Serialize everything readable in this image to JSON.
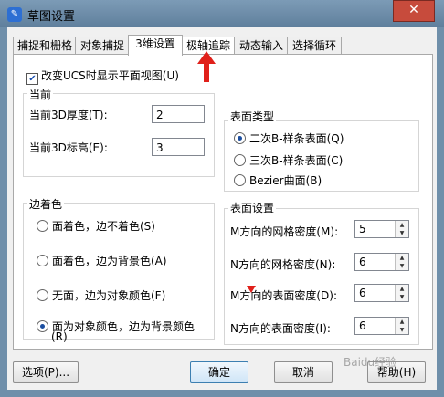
{
  "window": {
    "title": "草图设置",
    "close_label": "✕"
  },
  "tabs": [
    {
      "label": "捕捉和栅格"
    },
    {
      "label": "对象捕捉"
    },
    {
      "label": "3维设置"
    },
    {
      "label": "极轴追踪"
    },
    {
      "label": "动态输入"
    },
    {
      "label": "选择循环"
    }
  ],
  "active_tab": "3维设置",
  "panel": {
    "ucs_check": {
      "label": "改变UCS时显示平面视图(U)",
      "checked": true
    },
    "current": {
      "title": "当前",
      "thickness_label": "当前3D厚度(T):",
      "thickness_value": "2",
      "elevation_label": "当前3D标高(E):",
      "elevation_value": "3"
    },
    "edge_color": {
      "title": "边着色",
      "options": [
        {
          "label": "面着色，边不着色(S)",
          "checked": false
        },
        {
          "label": "面着色，边为背景色(A)",
          "checked": false
        },
        {
          "label": "无面，边为对象颜色(F)",
          "checked": false
        },
        {
          "label": "面为对象颜色，边为背景颜色",
          "label2": "(R)",
          "checked": true
        }
      ]
    },
    "surface_type": {
      "title": "表面类型",
      "options": [
        {
          "label": "二次B-样条表面(Q)",
          "checked": true
        },
        {
          "label": "三次B-样条表面(C)",
          "checked": false
        },
        {
          "label": "Bezier曲面(B)",
          "checked": false
        }
      ]
    },
    "surface_settings": {
      "title": "表面设置",
      "rows": [
        {
          "label": "M方向的网格密度(M):",
          "value": "5"
        },
        {
          "label": "N方向的网格密度(N):",
          "value": "6"
        },
        {
          "label": "M方向的表面密度(D):",
          "value": "6"
        },
        {
          "label": "N方向的表面密度(I):",
          "value": "6"
        }
      ]
    }
  },
  "buttons": {
    "options": "选项(P)...",
    "ok": "确定",
    "cancel": "取消",
    "help": "帮助(H)"
  },
  "watermark": "Baidu经验",
  "colors": {
    "accent": "#1b4ea0",
    "annotation": "#e0201a",
    "titlebar": "#6f8faa"
  }
}
